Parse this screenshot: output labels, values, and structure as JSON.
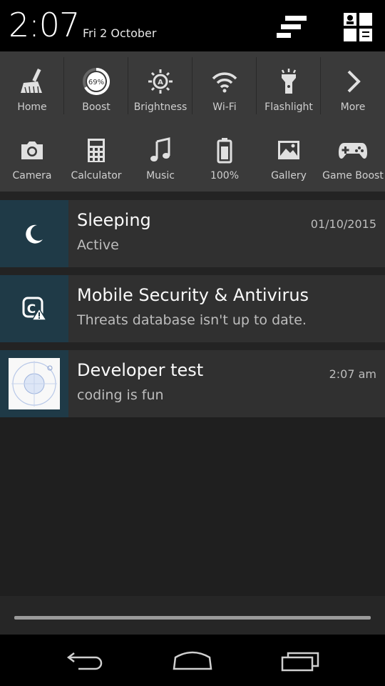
{
  "status": {
    "time": "2:07",
    "date": "Fri 2 October"
  },
  "quick_settings": {
    "row1": [
      {
        "label": "Home",
        "icon": "broom-icon"
      },
      {
        "label": "Boost",
        "icon": "boost-gauge-icon",
        "value": "69%"
      },
      {
        "label": "Brightness",
        "icon": "brightness-auto-icon"
      },
      {
        "label": "Wi-Fi",
        "icon": "wifi-icon"
      },
      {
        "label": "Flashlight",
        "icon": "flashlight-icon"
      },
      {
        "label": "More",
        "icon": "chevron-right-icon"
      }
    ],
    "row2": [
      {
        "label": "Camera",
        "icon": "camera-icon"
      },
      {
        "label": "Calculator",
        "icon": "calculator-icon"
      },
      {
        "label": "Music",
        "icon": "music-note-icon"
      },
      {
        "label": "100%",
        "icon": "battery-icon"
      },
      {
        "label": "Gallery",
        "icon": "gallery-icon"
      },
      {
        "label": "Game Boost",
        "icon": "gamepad-icon"
      }
    ]
  },
  "notifications": [
    {
      "title": "Sleeping",
      "text": "Active",
      "time": "01/10/2015",
      "icon": "moon-icon"
    },
    {
      "title": "Mobile Security & Antivirus",
      "text": "Threats database isn't up to date.",
      "time": "",
      "icon": "security-warning-icon"
    },
    {
      "title": "Developer test",
      "text": "coding is fun",
      "time": "2:07 am",
      "icon": "app-thumbnail-icon"
    }
  ],
  "colors": {
    "header_bg": "#000000",
    "quick_panel_bg": "#3a3a3a",
    "notification_bg": "#303030",
    "icon_box_bg": "#1f3a47"
  }
}
